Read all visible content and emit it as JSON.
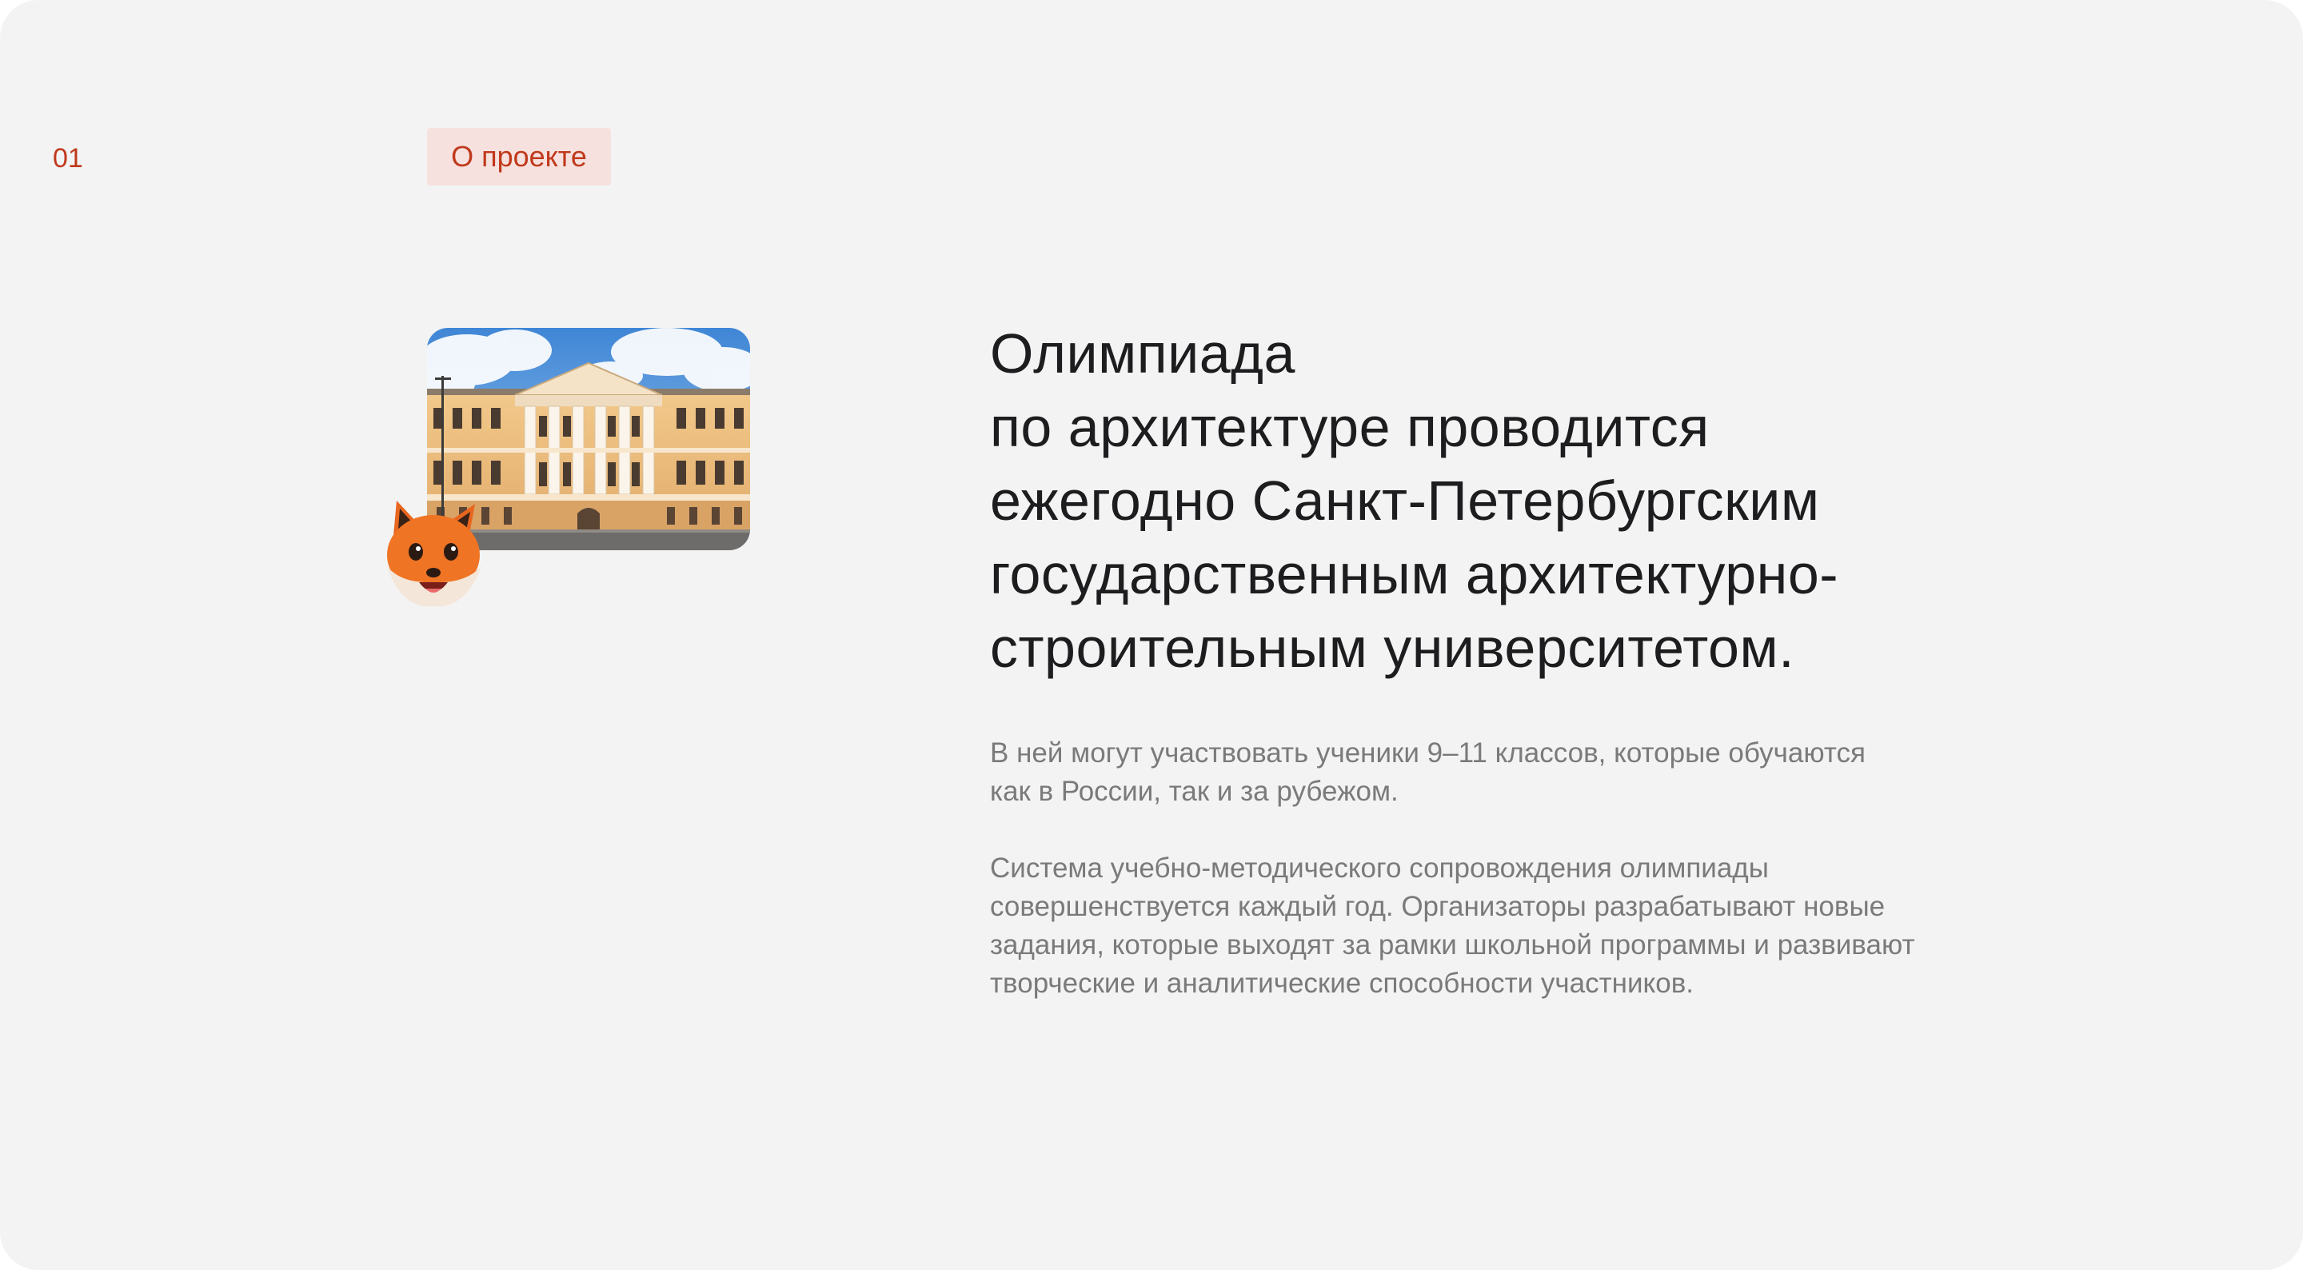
{
  "section": {
    "number": "01",
    "tag": "О проекте"
  },
  "images": {
    "photo_icon": "building-photo",
    "mascot_icon": "fox-mascot-icon"
  },
  "heading": {
    "lines": [
      "Олимпиада",
      "по архитектуре проводится",
      "ежегодно Санкт-Петербургским",
      "государственным архитектурно-",
      "строительным университетом."
    ]
  },
  "paragraphs": [
    {
      "lines": [
        "В ней могут участвовать ученики 9–11 классов, которые обучаются",
        "как в России, так и за рубежом."
      ]
    },
    {
      "lines": [
        "Система учебно-методического сопровождения олимпиады",
        "совершенствуется каждый год. Организаторы разрабатывают новые",
        "задания, которые выходят за рамки школьной программы и развивают",
        "творческие и аналитические способности участников."
      ]
    }
  ],
  "colors": {
    "background": "#f3f3f3",
    "accent": "#c0391b",
    "tag_background": "#f6e1df",
    "heading_text": "#1d1d1f",
    "body_text": "#7a7a7a"
  }
}
